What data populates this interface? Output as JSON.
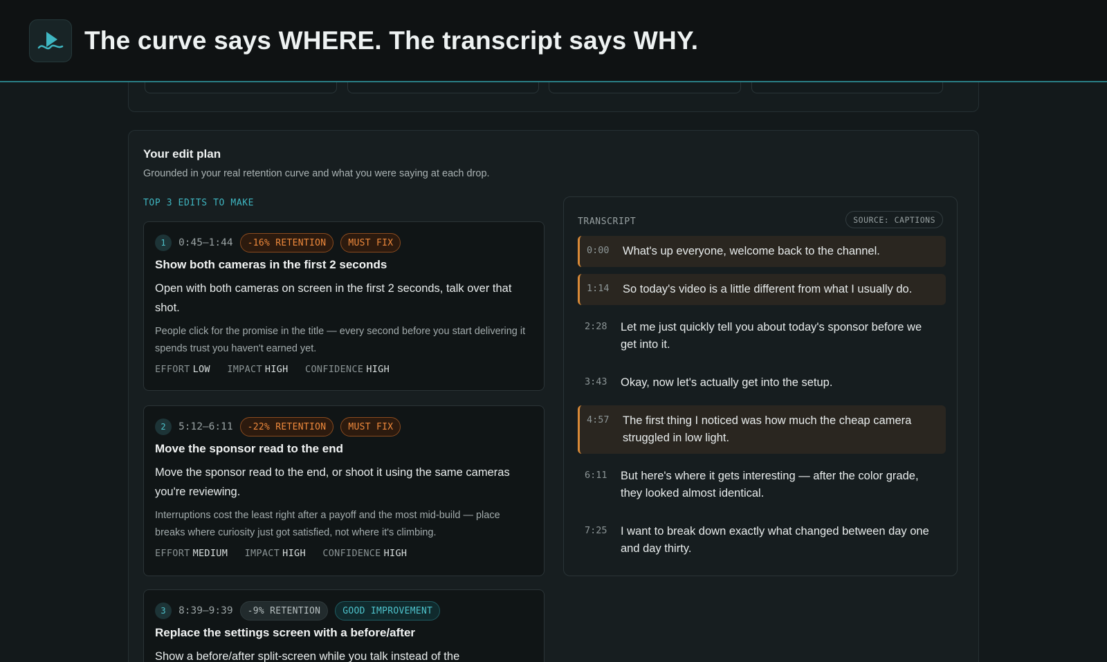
{
  "header": {
    "title": "The curve says WHERE. The transcript says WHY.",
    "logo_icon": "play-wave-icon"
  },
  "plan": {
    "title": "Your edit plan",
    "subtitle": "Grounded in your real retention curve and what you were saying at each drop.",
    "section_label": "TOP 3 EDITS TO MAKE",
    "metric_labels": {
      "effort": "EFFORT",
      "impact": "IMPACT",
      "confidence": "CONFIDENCE"
    },
    "edits": [
      {
        "num": "1",
        "range": "0:45–1:44",
        "retention": "-16% RETENTION",
        "priority": "MUST FIX",
        "title": "Show both cameras in the first 2 seconds",
        "action": "Open with both cameras on screen in the first 2 seconds, talk over that shot.",
        "why": "People click for the promise in the title — every second before you start delivering it spends trust you haven't earned yet.",
        "effort": "LOW",
        "impact": "HIGH",
        "confidence": "HIGH"
      },
      {
        "num": "2",
        "range": "5:12–6:11",
        "retention": "-22% RETENTION",
        "priority": "MUST FIX",
        "title": "Move the sponsor read to the end",
        "action": "Move the sponsor read to the end, or shoot it using the same cameras you're reviewing.",
        "why": "Interruptions cost the least right after a payoff and the most mid-build — place breaks where curiosity just got satisfied, not where it's climbing.",
        "effort": "MEDIUM",
        "impact": "HIGH",
        "confidence": "HIGH"
      },
      {
        "num": "3",
        "range": "8:39–9:39",
        "retention": "-9% RETENTION",
        "priority": "GOOD IMPROVEMENT",
        "title": "Replace the settings screen with a before/after",
        "action": "Show a before/after split-screen while you talk instead of the"
      }
    ]
  },
  "transcript": {
    "label": "TRANSCRIPT",
    "source": "SOURCE: CAPTIONS",
    "lines": [
      {
        "ts": "0:00",
        "text": "What's up everyone, welcome back to the channel.",
        "highlight": true
      },
      {
        "ts": "1:14",
        "text": "So today's video is a little different from what I usually do.",
        "highlight": true
      },
      {
        "ts": "2:28",
        "text": "Let me just quickly tell you about today's sponsor before we get into it.",
        "highlight": false
      },
      {
        "ts": "3:43",
        "text": "Okay, now let's actually get into the setup.",
        "highlight": false
      },
      {
        "ts": "4:57",
        "text": "The first thing I noticed was how much the cheap camera struggled in low light.",
        "highlight": true
      },
      {
        "ts": "6:11",
        "text": "But here's where it gets interesting — after the color grade, they looked almost identical.",
        "highlight": false
      },
      {
        "ts": "7:25",
        "text": "I want to break down exactly what changed between day one and day thirty.",
        "highlight": false
      }
    ]
  },
  "colors": {
    "accent": "#3fb7c2",
    "warning": "#f08a3c",
    "highlight_bar": "#d98a38"
  }
}
